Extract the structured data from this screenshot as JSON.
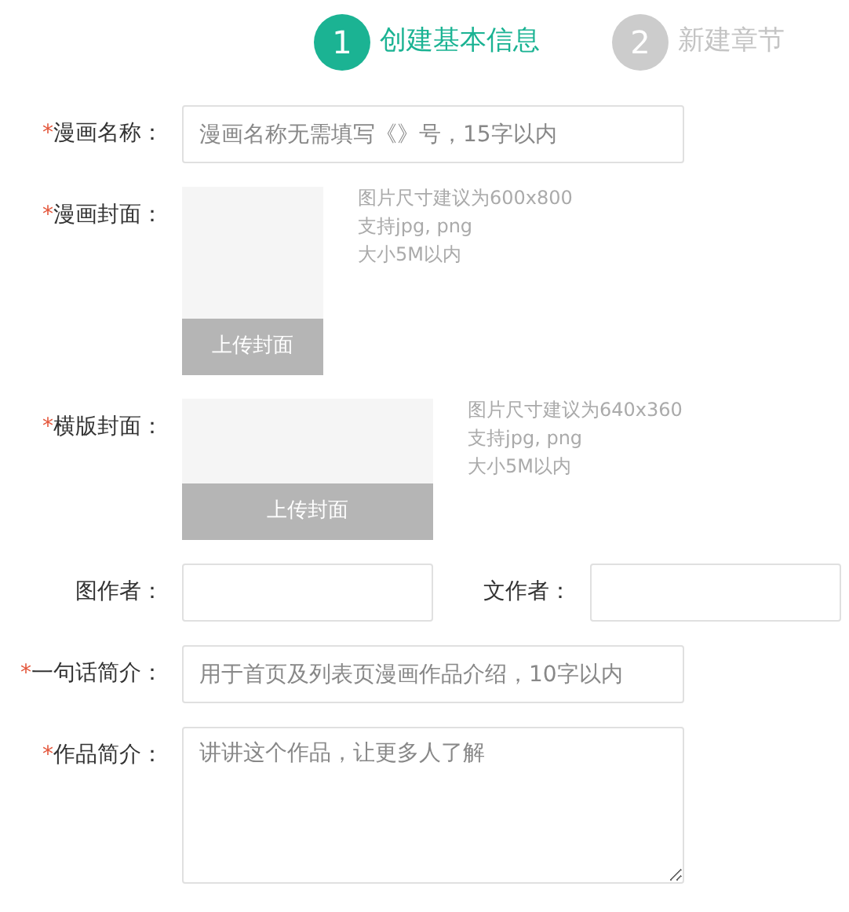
{
  "steps": [
    {
      "number": "1",
      "label": "创建基本信息",
      "selected": true
    },
    {
      "number": "2",
      "label": "新建章节",
      "selected": false
    }
  ],
  "fields": [
    {
      "kind": "text",
      "label": "漫画名称：",
      "marker": "*",
      "placeholder": "漫画名称无需填写《》号，15字以内"
    },
    {
      "kind": "upload_portrait",
      "label": "漫画封面：",
      "marker": "*",
      "button": "上传封面",
      "hints": [
        "图片尺寸建议为600x800",
        "支持jpg, png",
        "大小5M以内"
      ]
    },
    {
      "kind": "upload_landscape",
      "label": "横版封面：",
      "marker": "*",
      "button": "上传封面",
      "hints": [
        "图片尺寸建议为640x360",
        "支持jpg, png",
        "大小5M以内"
      ]
    },
    {
      "kind": "pair",
      "items": [
        {
          "label": "图作者："
        },
        {
          "label": "文作者："
        }
      ]
    },
    {
      "kind": "text",
      "label": "一句话简介：",
      "marker": "*",
      "placeholder": "用于首页及列表页漫画作品介绍，10字以内"
    },
    {
      "kind": "textarea",
      "label": "作品简介：",
      "marker": "*",
      "placeholder": "讲讲这个作品，让更多人了解"
    }
  ]
}
